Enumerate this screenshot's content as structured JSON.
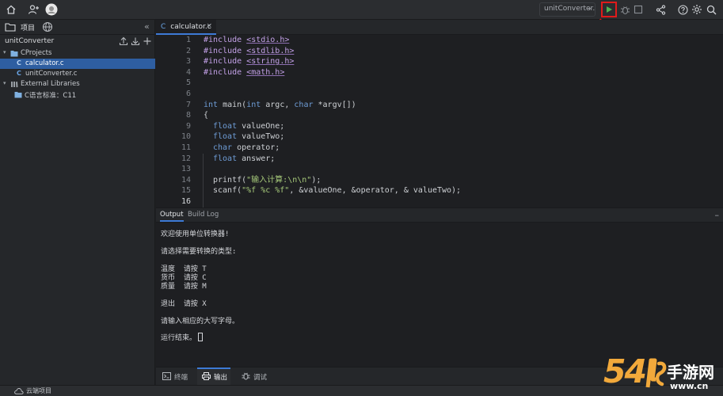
{
  "topbar": {
    "run_config": "unitConverter.c",
    "icons": [
      "home-icon",
      "add-user-icon",
      "avatar",
      "run-icon",
      "debug-icon",
      "stop-icon",
      "share-icon",
      "help-icon",
      "settings-icon",
      "search-icon"
    ]
  },
  "left_panel": {
    "tab_project": "项目",
    "project_name": "unitConverter",
    "tree": [
      {
        "label": "CProjects",
        "type": "folder",
        "depth": 0,
        "expanded": true
      },
      {
        "label": "calculator.c",
        "type": "c-file",
        "depth": 1,
        "selected": true
      },
      {
        "label": "unitConverter.c",
        "type": "c-file",
        "depth": 1,
        "selected": false
      },
      {
        "label": "External Libraries",
        "type": "library",
        "depth": 0,
        "expanded": true
      },
      {
        "label": "C语言标准：C11",
        "type": "folder",
        "depth": 1
      }
    ]
  },
  "editor": {
    "tab_label": "calculator.c",
    "lines": [
      {
        "n": "1"
      },
      {
        "n": "2"
      },
      {
        "n": "3"
      },
      {
        "n": "4"
      },
      {
        "n": "5"
      },
      {
        "n": "6"
      },
      {
        "n": "7"
      },
      {
        "n": "8"
      },
      {
        "n": "9"
      },
      {
        "n": "10"
      },
      {
        "n": "11"
      },
      {
        "n": "12"
      },
      {
        "n": "13"
      },
      {
        "n": "14"
      },
      {
        "n": "15"
      },
      {
        "n": "16"
      }
    ],
    "code": {
      "l1": [
        "#include ",
        "<stdio.h>"
      ],
      "l2": [
        "#include ",
        "<stdlib.h>"
      ],
      "l3": [
        "#include ",
        "<string.h>"
      ],
      "l4": [
        "#include ",
        "<math.h>"
      ],
      "l7": [
        "int",
        " main(",
        "int",
        " argc, ",
        "char",
        " *argv[])"
      ],
      "l8": "{",
      "l9": [
        "float",
        " valueOne;"
      ],
      "l10": [
        "float",
        " valueTwo;"
      ],
      "l11": [
        "char",
        " operator;"
      ],
      "l12": [
        "float",
        " answer;"
      ],
      "l14": [
        "printf(",
        "\"输入计算:",
        "\\n\\n\"",
        ");"
      ],
      "l15": [
        "scanf(",
        "\"%f %c %f\"",
        ", &valueOne, &operator, & valueTwo);"
      ]
    }
  },
  "output_panel": {
    "tabs": [
      "Output",
      "Build Log"
    ],
    "active_tab": "Output",
    "lines": [
      "欢迎使用单位转换器!",
      "请选择需要转换的类型:",
      "温度  请按 T",
      "货币  请按 C",
      "质量  请按 M",
      "退出  请按 X",
      "请输入相应的大写字母。",
      "运行结束。"
    ]
  },
  "tool_tabs": {
    "terminal": "终端",
    "output": "输出",
    "debug": "调试",
    "active": "输出"
  },
  "statusbar": {
    "label": "云端项目"
  },
  "watermark": {
    "number": "54",
    "glyph": "lg",
    "cn": "手游网",
    "url": "www.cn"
  },
  "colors": {
    "accent": "#3d7ad6",
    "selection": "#2e5ea1",
    "highlight_red": "#e01b1b",
    "run_green": "#4fb34f"
  }
}
